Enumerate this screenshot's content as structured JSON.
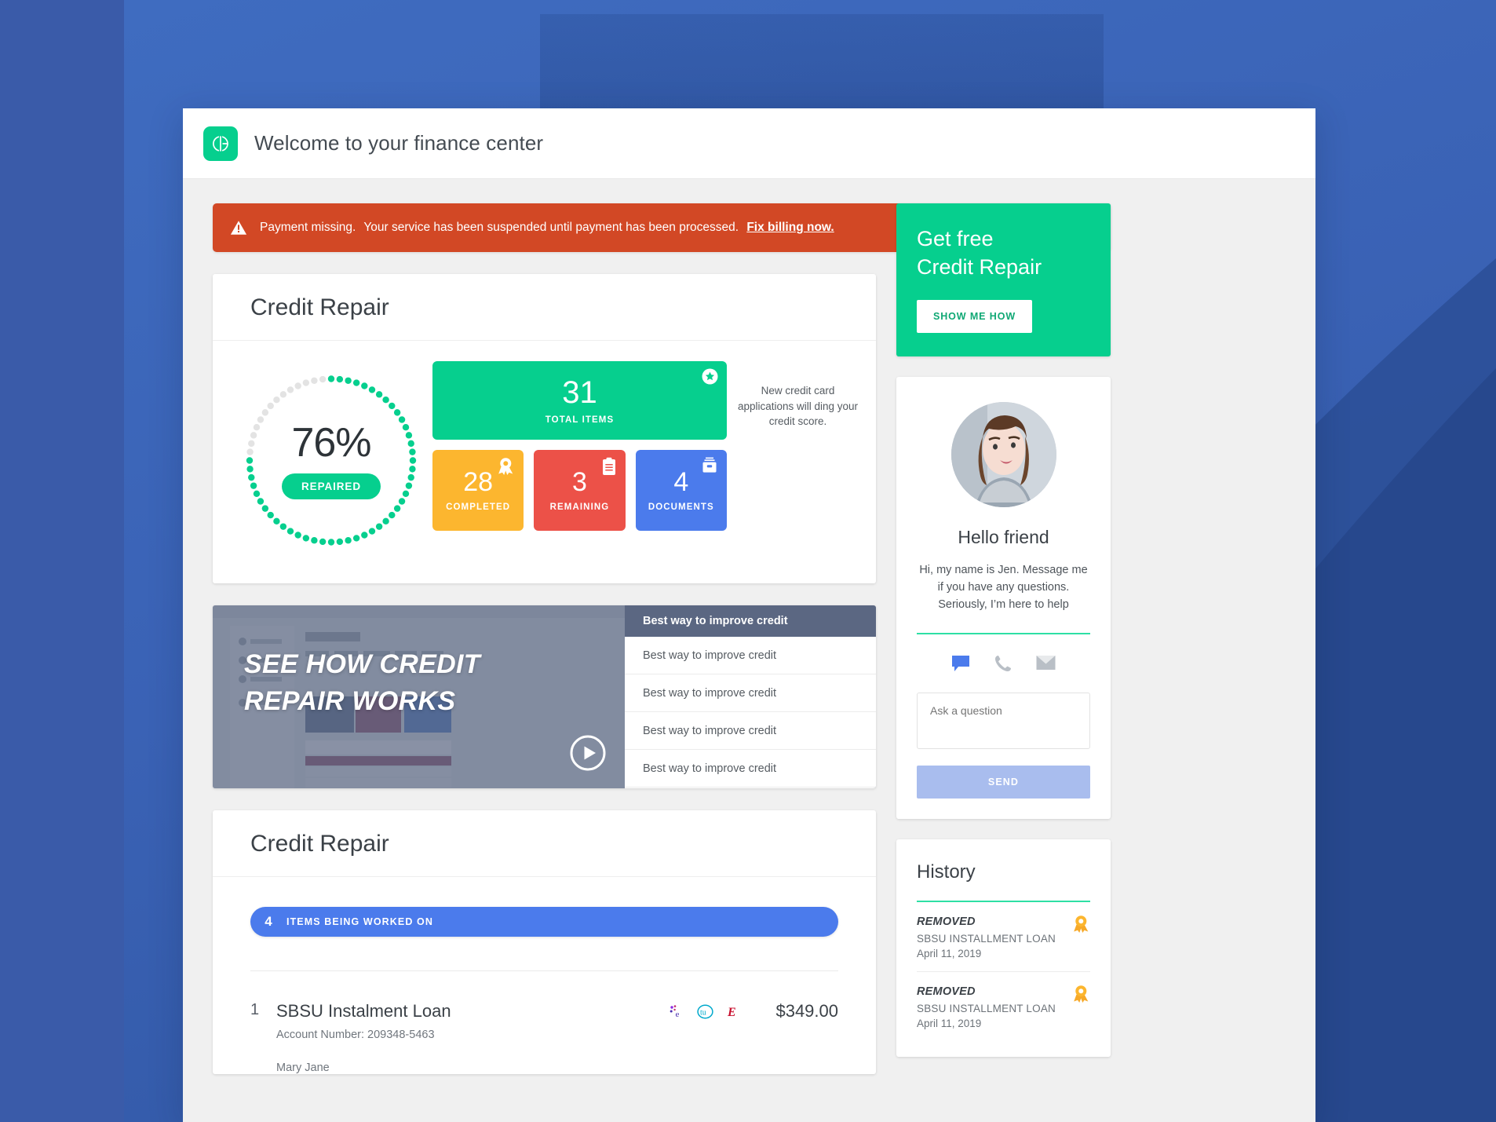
{
  "topbar": {
    "logo_icon": "brand-logo-icon",
    "title": "Welcome to your finance center"
  },
  "alert": {
    "icon": "warning-triangle-icon",
    "message": "Payment missing.",
    "detail": "Your service has been suspended until payment has been processed.",
    "link": "Fix billing now.",
    "color": "#d24825"
  },
  "credit_repair": {
    "title": "Credit Repair",
    "ring": {
      "percent_label": "76%",
      "percent_value": 76,
      "pill_label": "REPAIRED",
      "progress_color": "#06cf8e",
      "track_color": "#e3e3e3"
    },
    "tiles": [
      {
        "value": "31",
        "label": "TOTAL ITEMS",
        "icon": "star-badge-icon",
        "color": "#06cf8e"
      },
      {
        "value": "28",
        "label": "COMPLETED",
        "icon": "award-ribbon-icon",
        "color": "#fcb62f"
      },
      {
        "value": "3",
        "label": "REMAINING",
        "icon": "clipboard-icon",
        "color": "#ec5148"
      },
      {
        "value": "4",
        "label": "DOCUMENTS",
        "icon": "file-box-icon",
        "color": "#4b7bec"
      }
    ],
    "note": "New credit card applications will ding your credit score."
  },
  "video": {
    "headline_line1": "SEE HOW CREDIT",
    "headline_line2": "REPAIR WORKS",
    "play_icon": "play-circle-icon",
    "playlist_header": "Best way to improve credit",
    "playlist": [
      "Best way to improve credit",
      "Best way to improve credit",
      "Best way to improve credit",
      "Best way to improve credit",
      "Best way to improve credit"
    ]
  },
  "credit_repair_list": {
    "title": "Credit Repair",
    "worked_count": "4",
    "worked_label": "ITEMS BEING WORKED ON",
    "items": [
      {
        "index": "1",
        "title": "SBSU Instalment Loan",
        "account": "Account Number: 209348-5463",
        "person": "Mary Jane",
        "amount": "$349.00",
        "bureaus": [
          "experian-icon",
          "transunion-icon",
          "equifax-icon"
        ]
      }
    ]
  },
  "promo": {
    "line1": "Get free",
    "line2": "Credit Repair",
    "button": "SHOW ME HOW",
    "color": "#06cf8e"
  },
  "agent": {
    "avatar_icon": "agent-avatar",
    "heading": "Hello friend",
    "message": "Hi, my name is Jen. Message me if you have any questions. Seriously, I’m here to help",
    "contact_icons": [
      "chat-bubble-icon",
      "phone-icon",
      "mail-icon"
    ],
    "input_placeholder": "Ask a question",
    "input_value": "",
    "send_label": "SEND",
    "accent_color": "#2ee0a5"
  },
  "history": {
    "title": "History",
    "items": [
      {
        "status": "REMOVED",
        "name": "SBSU INSTALLMENT LOAN",
        "date": "April 11, 2019",
        "badge": "award-ribbon-icon"
      },
      {
        "status": "REMOVED",
        "name": "SBSU INSTALLMENT LOAN",
        "date": "April 11, 2019",
        "badge": "award-ribbon-icon"
      }
    ]
  }
}
